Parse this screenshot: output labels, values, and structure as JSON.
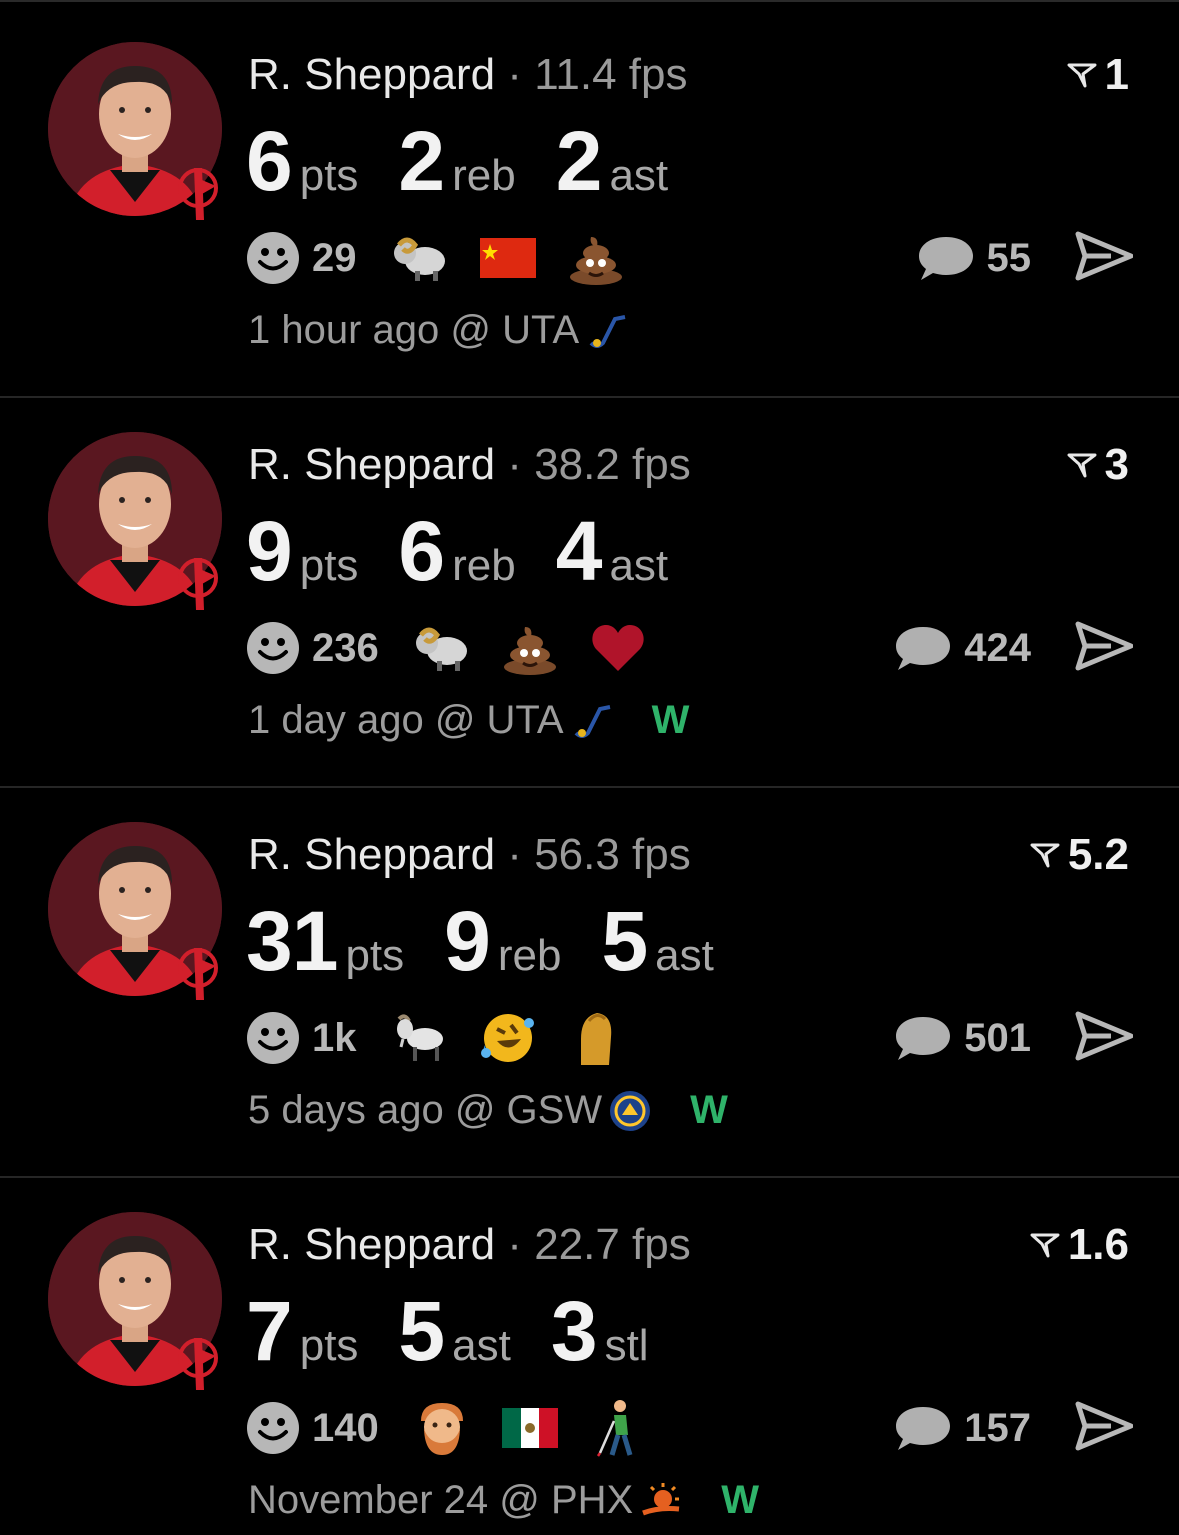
{
  "colors": {
    "background": "#000000",
    "win": "#2fb36a",
    "avatar_bg": "#5a1720",
    "muted_text": "#9c9c9c"
  },
  "posts": [
    {
      "player": "R. Sheppard",
      "separator": "·",
      "fps": "11.4 fps",
      "rank": "1",
      "stats": [
        {
          "num": "6",
          "unit": "pts"
        },
        {
          "num": "2",
          "unit": "reb"
        },
        {
          "num": "2",
          "unit": "ast"
        }
      ],
      "reaction_count": "29",
      "emojis": [
        "ram-emoji",
        "china-flag-emoji",
        "poop-emoji"
      ],
      "comment_count": "55",
      "when": "1 hour ago @ UTA",
      "opponent_icon": "jazz-logo-icon",
      "result": ""
    },
    {
      "player": "R. Sheppard",
      "separator": "·",
      "fps": "38.2 fps",
      "rank": "3",
      "stats": [
        {
          "num": "9",
          "unit": "pts"
        },
        {
          "num": "6",
          "unit": "reb"
        },
        {
          "num": "4",
          "unit": "ast"
        }
      ],
      "reaction_count": "236",
      "emojis": [
        "ram-emoji",
        "poop-emoji",
        "heart-emoji"
      ],
      "comment_count": "424",
      "when": "1 day ago @ UTA",
      "opponent_icon": "jazz-logo-icon",
      "result": "W"
    },
    {
      "player": "R. Sheppard",
      "separator": "·",
      "fps": "56.3 fps",
      "rank": "5.2",
      "stats": [
        {
          "num": "31",
          "unit": "pts"
        },
        {
          "num": "9",
          "unit": "reb"
        },
        {
          "num": "5",
          "unit": "ast"
        }
      ],
      "reaction_count": "1k",
      "emojis": [
        "goat-emoji",
        "rofl-emoji",
        "pinched-fingers-emoji"
      ],
      "comment_count": "501",
      "when": "5 days ago @ GSW",
      "opponent_icon": "warriors-logo-icon",
      "result": "W"
    },
    {
      "player": "R. Sheppard",
      "separator": "·",
      "fps": "22.7 fps",
      "rank": "1.6",
      "stats": [
        {
          "num": "7",
          "unit": "pts"
        },
        {
          "num": "5",
          "unit": "ast"
        },
        {
          "num": "3",
          "unit": "stl"
        }
      ],
      "reaction_count": "140",
      "emojis": [
        "bearded-man-emoji",
        "mexico-flag-emoji",
        "person-with-cane-emoji"
      ],
      "comment_count": "157",
      "when": "November 24 @ PHX",
      "opponent_icon": "suns-logo-icon",
      "result": "W"
    }
  ]
}
